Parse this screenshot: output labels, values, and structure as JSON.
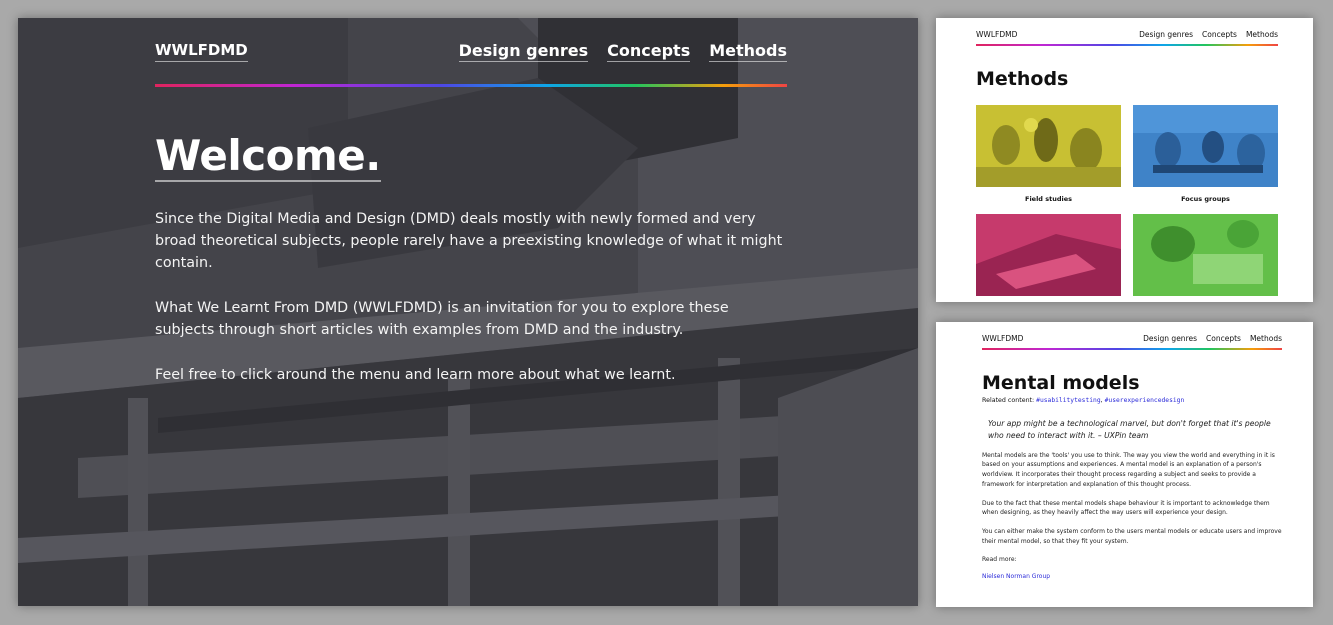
{
  "welcome_page": {
    "brand": "WWLFDMD",
    "nav": [
      "Design genres",
      "Concepts",
      "Methods"
    ],
    "title": "Welcome.",
    "paragraphs": [
      "Since the Digital Media and Design (DMD) deals mostly with newly formed and very broad theoretical subjects, people rarely have a preexisting knowledge of what it might contain.",
      "What We Learnt From DMD (WWLFDMD) is an invitation for you to explore these subjects through short articles with examples from DMD and the industry.",
      "Feel free to click around the menu and learn more about what we learnt."
    ]
  },
  "methods_page": {
    "brand": "WWLFDMD",
    "nav": [
      "Design genres",
      "Concepts",
      "Methods"
    ],
    "title": "Methods",
    "tiles": [
      {
        "caption": "Field studies",
        "color": "#c8c033"
      },
      {
        "caption": "Focus groups",
        "color": "#3f83c8"
      },
      {
        "caption": "",
        "color": "#c63a6c"
      },
      {
        "caption": "",
        "color": "#63bf49"
      }
    ]
  },
  "mental_models_page": {
    "brand": "WWLFDMD",
    "nav": [
      "Design genres",
      "Concepts",
      "Methods"
    ],
    "title": "Mental models",
    "related_label": "Related content: ",
    "tags": [
      "#usabilitytesting",
      "#userexperiencedesign"
    ],
    "tag_separator": ", ",
    "quote": "Your app might be a technological marvel, but don't forget that it's people who need to interact with it. – UXPin team",
    "paragraphs": [
      "Mental models are the 'tools' you use to think. The way you view the world and everything in it is based on your assumptions and experiences. A mental model is an explanation of a person's worldview. It incorporates their thought process regarding a subject and seeks to provide a framework for interpretation and explanation of this thought process.",
      "Due to the fact that these mental models shape behaviour it is important to acknowledge them when designing, as they heavily affect the way users will experience your design.",
      "You can either make the system conform to the users mental models or educate users and improve their mental model, so that they fit your system."
    ],
    "read_more_label": "Read more:",
    "read_more_link": "Nielsen Norman Group"
  }
}
